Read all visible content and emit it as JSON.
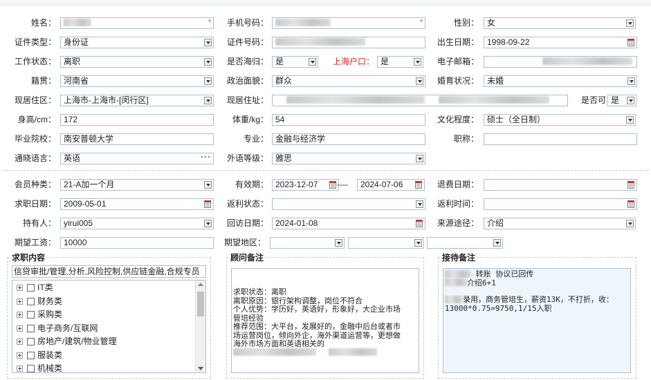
{
  "basic": {
    "name_label": "姓名：",
    "phone_label": "手机号码：",
    "gender_label": "性别：",
    "gender_value": "女",
    "id_type_label": "证件类型：",
    "id_type_value": "身份证",
    "id_no_label": "证件号码：",
    "birth_label": "出生日期：",
    "birth_value": "1998-09-22",
    "work_status_label": "工作状态：",
    "work_status_value": "离职",
    "returnee_label": "是否海归：",
    "returnee_value": "是",
    "hukou_label": "上海户口：",
    "hukou_value": "是",
    "email_label": "电子邮箱：",
    "native_label": "籍贯：",
    "native_value": "河南省",
    "political_label": "政治面貌：",
    "political_value": "群众",
    "marital_label": "婚育状况：",
    "marital_value": "未婚",
    "residence_label": "现居住区：",
    "residence_value": "上海市-上海市-[闵行区]",
    "address_label": "现居住址：",
    "can_label": "是否可",
    "can_value": "是",
    "height_label": "身高/cm：",
    "height_value": "172",
    "weight_label": "体重/kg：",
    "weight_value": "54",
    "education_label": "文化程度：",
    "education_value": "硕士（全日制）",
    "school_label": "毕业院校：",
    "school_value": "南安普顿大学",
    "major_label": "专业：",
    "major_value": "金融与经济学",
    "title_label": "职称：",
    "language_label": "通晓语言：",
    "language_value": "英语",
    "lang_level_label": "外语等级：",
    "lang_level_value": "雅思"
  },
  "member": {
    "type_label": "会员种类：",
    "type_value": "21-A加一个月",
    "valid_label": "有效期：",
    "valid_from": "2023-12-07",
    "valid_sep": "----",
    "valid_to": "2024-07-06",
    "refund_date_label": "退费日期：",
    "job_date_label": "求职日期：",
    "job_date_value": "2009-05-01",
    "rebate_status_label": "返利状态：",
    "rebate_time_label": "返利时间：",
    "holder_label": "持有人：",
    "holder_value": "yirui005",
    "visit_label": "回访日期：",
    "visit_value": "2024-01-08",
    "source_label": "来源途径：",
    "source_value": "介绍",
    "salary_label": "期望工资：",
    "salary_value": "10000",
    "region_label": "期望地区："
  },
  "job_content": {
    "title": "求职内容",
    "summary": "信贷审批/管理,分析,风险控制,供应链金融,合规专员",
    "categories": [
      "IT类",
      "财务类",
      "采购类",
      "电子商务/互联网",
      "房地产/建筑/物业管理",
      "服装类",
      "机械类"
    ]
  },
  "advisor_notes": {
    "title": "顾问备注",
    "lines": [
      "求职状态：离职",
      "离职原因：银行架构调整，岗位不符合",
      "个人优势：学历好，英语好，形象好，大企业市场",
      "管培经验",
      "推荐范围：大平台，发展好的，金融中后台或者市",
      "场运营岗位，倾向外企，海外渠道运营等，更想做",
      "海外市场方面和英语相关的"
    ]
  },
  "reception_notes": {
    "title": "接待备注",
    "line1": "转账 协议已回传",
    "line2": "介绍6+1",
    "line3": "录用，商务管培生，薪资13K，不打折，收：",
    "line4": "13000*0.75=9750,1/15入职"
  },
  "colors": {
    "border": "#a9bfd3",
    "hukou_label": "#dd2222",
    "required": "#ee2222",
    "note_bg": "#eef6fc"
  },
  "icons": [
    "calendar-icon",
    "dropdown-arrow-icon",
    "more-dots-icon",
    "tree-expand-icon",
    "checkbox-icon"
  ]
}
